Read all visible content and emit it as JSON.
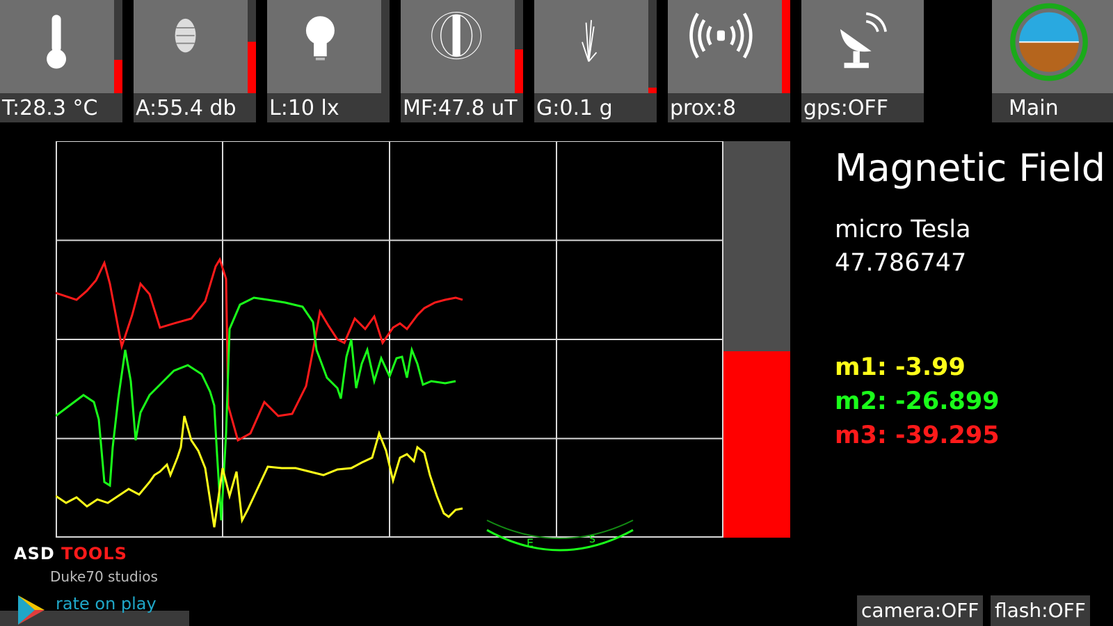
{
  "sensor_tiles": [
    {
      "id": "temperature",
      "label": "T:28.3 °C",
      "icon": "thermometer-icon",
      "level": 0.36
    },
    {
      "id": "audio",
      "label": "A:55.4 db",
      "icon": "microphone-icon",
      "level": 0.55
    },
    {
      "id": "light",
      "label": "L:10 lx",
      "icon": "lightbulb-icon",
      "level": 0.0
    },
    {
      "id": "magnetic",
      "label": "MF:47.8 uT",
      "icon": "magnet-field-icon",
      "level": 0.47
    },
    {
      "id": "gravity",
      "label": "G:0.1 g",
      "icon": "gravity-icon",
      "level": 0.06
    },
    {
      "id": "proximity",
      "label": "prox:8",
      "icon": "signal-waves-icon",
      "level": 1.0
    },
    {
      "id": "gps",
      "label": "gps:OFF",
      "icon": "satellite-dish-icon",
      "level": null
    },
    {
      "id": "main",
      "label": "Main",
      "icon": "globe-compass-icon",
      "level": null
    }
  ],
  "info": {
    "title": "Magnetic Field",
    "unit": "micro Tesla",
    "value": "47.786747",
    "m1": "m1: -3.99",
    "m2": "m2: -26.899",
    "m3": "m3: -39.295"
  },
  "colors": {
    "m1": "#ffff1a",
    "m2": "#1aff1a",
    "m3": "#ff1a1a",
    "accent": "#ff0000",
    "grid": "#d9d9d9"
  },
  "level_meter": {
    "value": 0.47
  },
  "brand": {
    "name_part1": "ASD ",
    "name_part2": "TOOLS",
    "studio": "Duke70 studios",
    "rate": "rate on play"
  },
  "buttons": {
    "camera": "camera:OFF",
    "flash": "flash:OFF"
  },
  "compass_arc_glyphs": [
    "E",
    "S"
  ]
}
